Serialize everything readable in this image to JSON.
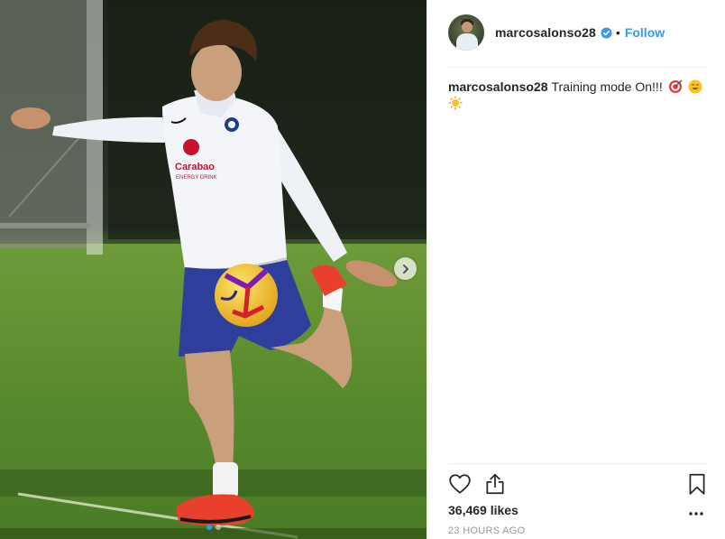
{
  "post": {
    "username": "marcosalonso28",
    "separator": "•",
    "follow_label": "Follow",
    "caption_user": "marcosalonso28",
    "caption_text": "Training mode On!!!",
    "caption_emojis": [
      "direct-hit-emoji",
      "smiling-face-emoji",
      "sun-emoji"
    ],
    "likes_text": "36,469 likes",
    "timestamp": "23 HOURS AGO",
    "image": {
      "sponsor_text_1": "Carabao",
      "sponsor_text_2": "ENERGY DRINK",
      "carousel": {
        "count": 2,
        "active_index": 0
      }
    }
  },
  "colors": {
    "accent": "#3897f0",
    "text": "#262626",
    "muted": "#999999",
    "divider": "#efefef"
  },
  "icons": [
    "verified-badge-icon",
    "chevron-right-icon",
    "heart-icon",
    "share-icon",
    "bookmark-icon",
    "more-options-icon"
  ]
}
